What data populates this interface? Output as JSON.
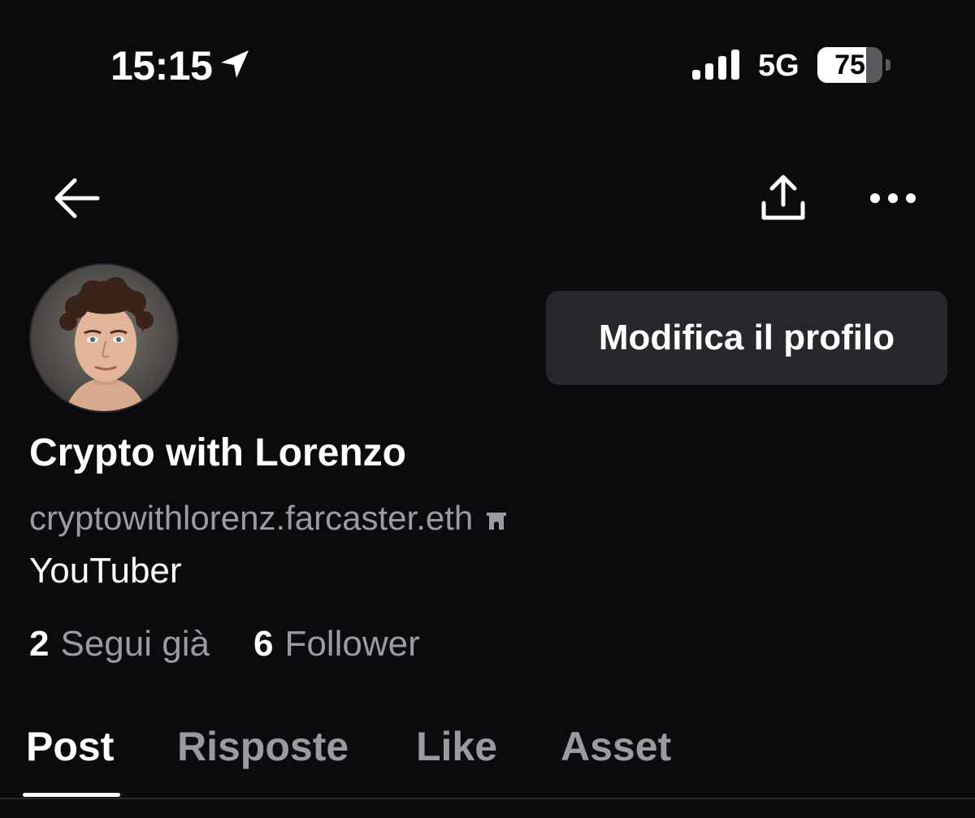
{
  "status_bar": {
    "time": "15:15",
    "network": "5G",
    "battery_level": 75,
    "battery_text": "75"
  },
  "nav": {
    "back_icon": "arrow-left-icon",
    "share_icon": "share-icon",
    "more_icon": "more-horizontal-icon"
  },
  "profile": {
    "avatar_icon": "avatar",
    "edit_button_label": "Modifica il profilo",
    "display_name": "Crypto with Lorenzo",
    "username": "cryptowithlorenz.farcaster.eth",
    "username_badge_icon": "arch-icon",
    "bio": "YouTuber",
    "stats": {
      "following_count": "2",
      "following_label": "Segui già",
      "followers_count": "6",
      "followers_label": "Follower"
    }
  },
  "tabs": [
    {
      "label": "Post",
      "active": true
    },
    {
      "label": "Risposte",
      "active": false
    },
    {
      "label": "Like",
      "active": false
    },
    {
      "label": "Asset",
      "active": false
    }
  ],
  "colors": {
    "background": "#0b0b0d",
    "primary_text": "#ffffff",
    "secondary_text": "#9b9ba3",
    "button_background": "#26282c"
  }
}
